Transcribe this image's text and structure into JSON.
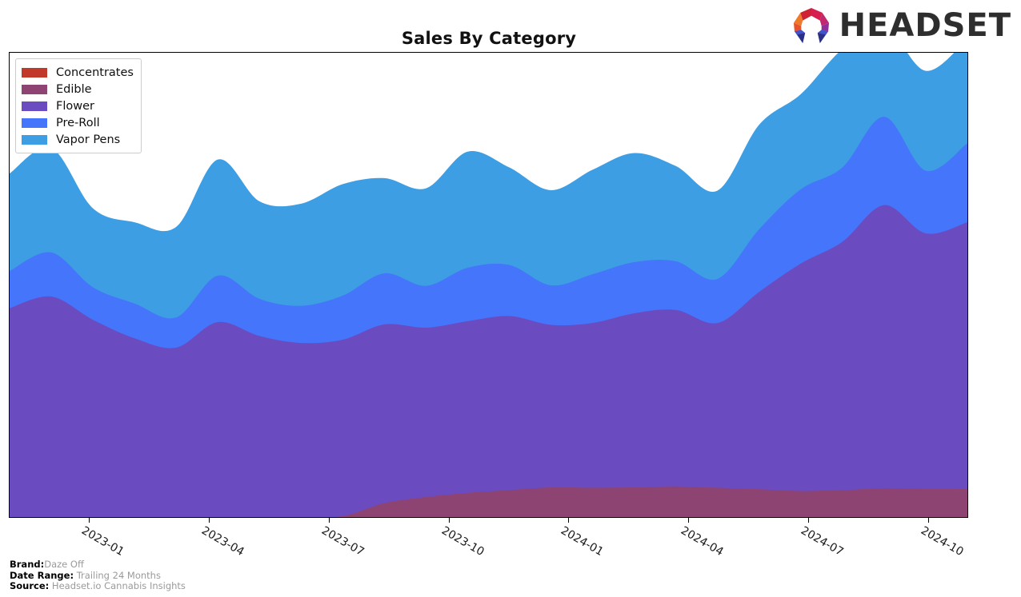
{
  "header": {
    "title": "Sales By Category",
    "logo_word": "HEADSET",
    "logo_mark_name": "headset-logo-mark"
  },
  "footer": {
    "brand_key": "Brand:",
    "brand_value": "Daze Off",
    "date_range_key": "Date Range:",
    "date_range_value": "Trailing 24 Months",
    "source_key": "Source:",
    "source_value": "Headset.io Cannabis Insights"
  },
  "legend": {
    "position": "upper-left",
    "items": [
      {
        "label": "Concentrates",
        "color": "#c0392b"
      },
      {
        "label": "Edible",
        "color": "#8e4472"
      },
      {
        "label": "Flower",
        "color": "#6a4cc0"
      },
      {
        "label": "Pre-Roll",
        "color": "#4575fb"
      },
      {
        "label": "Vapor Pens",
        "color": "#3d9ee4"
      }
    ]
  },
  "chart_data": {
    "type": "area",
    "stacked": true,
    "title": "Sales By Category",
    "xlabel": "",
    "ylabel": "",
    "grid": false,
    "legend_position": "upper left",
    "x_tick_labels": [
      "2023-01",
      "2023-04",
      "2023-07",
      "2023-10",
      "2024-01",
      "2024-04",
      "2024-07",
      "2024-10"
    ],
    "x_tick_positions": [
      0.0833,
      0.2083,
      0.3333,
      0.4583,
      0.5833,
      0.7083,
      0.8333,
      0.9583
    ],
    "x": [
      "2022-11",
      "2022-12",
      "2023-01",
      "2023-02",
      "2023-03",
      "2023-04",
      "2023-05",
      "2023-06",
      "2023-07",
      "2023-08",
      "2023-09",
      "2023-10",
      "2023-11",
      "2023-12",
      "2024-01",
      "2024-02",
      "2024-03",
      "2024-04",
      "2024-05",
      "2024-06",
      "2024-07",
      "2024-08",
      "2024-09",
      "2024-10"
    ],
    "ylim": [
      0,
      100
    ],
    "series": [
      {
        "name": "Concentrates",
        "color": "#c0392b",
        "values": [
          0.0,
          0.0,
          0.0,
          0.0,
          0.0,
          0.0,
          0.0,
          0.0,
          0.0,
          0.0,
          0.0,
          0.0,
          0.0,
          0.0,
          0.0,
          0.0,
          0.0,
          0.0,
          0.0,
          0.0,
          0.0,
          0.0,
          0.0,
          0.0
        ]
      },
      {
        "name": "Edible",
        "color": "#8e4472",
        "values": [
          0.0,
          0.0,
          0.0,
          0.0,
          0.0,
          0.0,
          0.0,
          0.0,
          0.2,
          3.0,
          4.3,
          5.2,
          5.8,
          6.4,
          6.3,
          6.4,
          6.6,
          6.3,
          6.0,
          5.6,
          5.8,
          6.2,
          6.1,
          6.0
        ]
      },
      {
        "name": "Flower",
        "color": "#6a4cc0",
        "values": [
          45.0,
          47.5,
          42.5,
          38.5,
          36.5,
          42.0,
          39.0,
          37.5,
          38.0,
          38.5,
          36.5,
          37.0,
          37.5,
          35.0,
          35.5,
          37.5,
          38.0,
          35.5,
          42.5,
          49.0,
          53.5,
          61.0,
          55.0,
          57.5
        ]
      },
      {
        "name": "Pre-Roll",
        "color": "#4575fb",
        "values": [
          8.0,
          9.5,
          7.0,
          7.5,
          6.5,
          10.0,
          8.0,
          8.0,
          9.5,
          11.0,
          9.0,
          11.5,
          11.0,
          8.5,
          10.5,
          11.0,
          10.5,
          9.5,
          13.5,
          16.0,
          16.0,
          19.0,
          13.5,
          17.0
        ]
      },
      {
        "name": "Vapor Pens",
        "color": "#3d9ee4",
        "values": [
          21.0,
          22.5,
          17.0,
          17.5,
          19.5,
          25.0,
          21.0,
          22.0,
          24.0,
          20.5,
          21.0,
          25.0,
          21.0,
          20.5,
          22.5,
          23.5,
          20.5,
          19.0,
          22.5,
          20.5,
          25.5,
          19.5,
          21.5,
          22.5
        ]
      }
    ]
  }
}
